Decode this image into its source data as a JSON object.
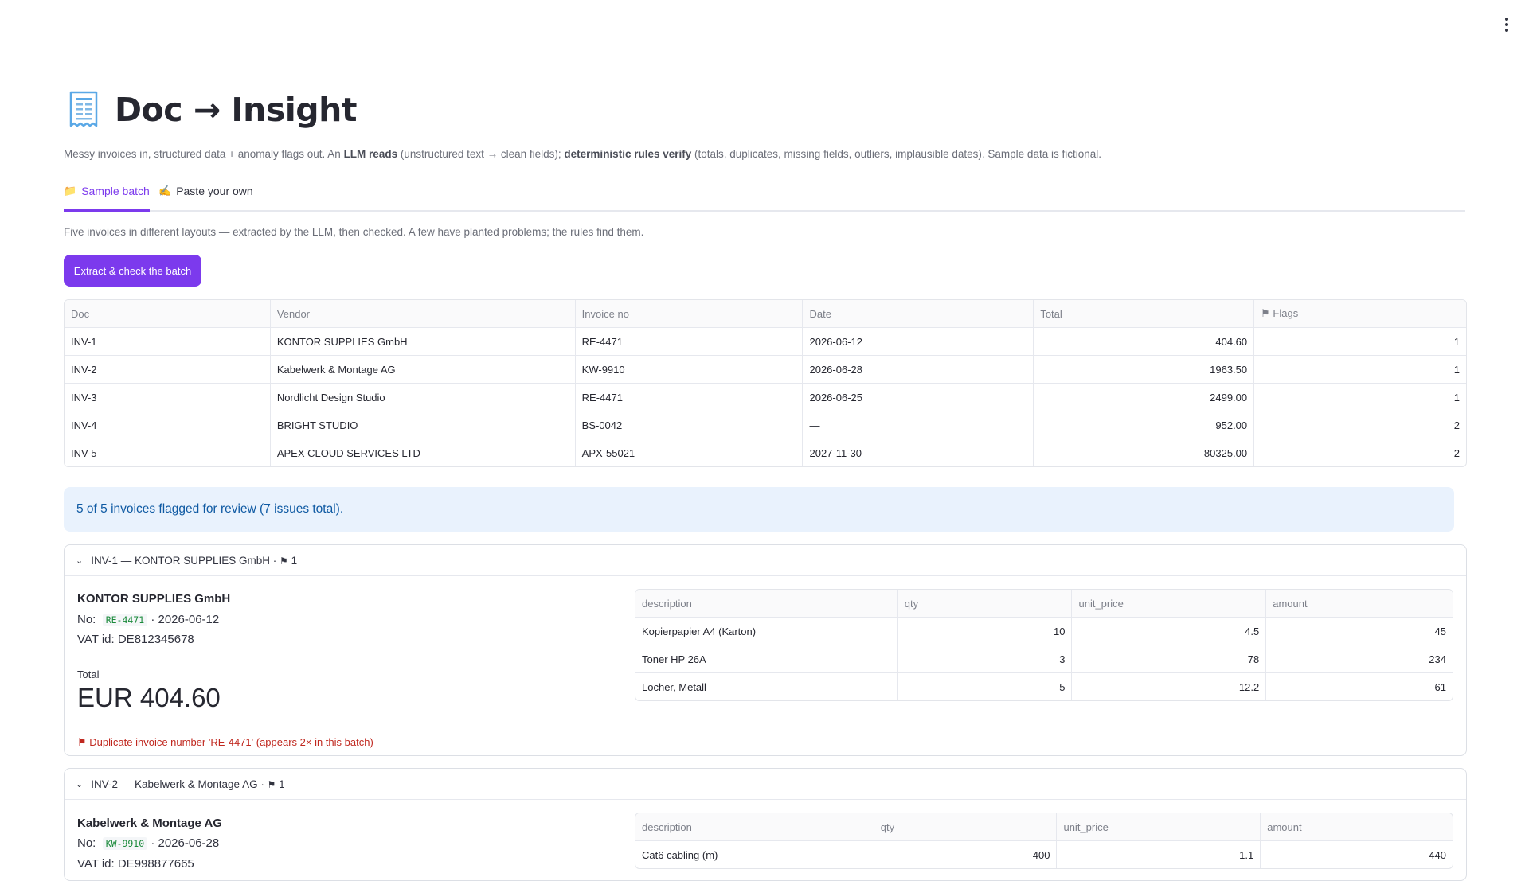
{
  "app": {
    "title": "Doc → Insight",
    "subtitle_parts": [
      "Messy invoices in, structured data + anomaly flags out. An ",
      "LLM reads",
      " (unstructured text → clean fields); ",
      "deterministic rules verify",
      " (totals, duplicates, missing fields, outliers, implausible dates). Sample data is fictional."
    ]
  },
  "tabs": [
    {
      "icon": "📁",
      "label": "Sample batch",
      "active": true
    },
    {
      "icon": "✍️",
      "label": "Paste your own",
      "active": false
    }
  ],
  "sample": {
    "description": "Five invoices in different layouts — extracted by the LLM, then checked. A few have planted problems; the rules find them.",
    "button_label": "Extract & check the batch"
  },
  "results_table": {
    "headers": [
      "Doc",
      "Vendor",
      "Invoice no",
      "Date",
      "Total",
      "Flags"
    ],
    "rows": [
      [
        "INV-1",
        "KONTOR SUPPLIES GmbH",
        "RE-4471",
        "2026-06-12",
        "404.60",
        "1"
      ],
      [
        "INV-2",
        "Kabelwerk & Montage AG",
        "KW-9910",
        "2026-06-28",
        "1963.50",
        "1"
      ],
      [
        "INV-3",
        "Nordlicht Design Studio",
        "RE-4471",
        "2026-06-25",
        "2499.00",
        "1"
      ],
      [
        "INV-4",
        "BRIGHT STUDIO",
        "BS-0042",
        "—",
        "952.00",
        "2"
      ],
      [
        "INV-5",
        "APEX CLOUD SERVICES LTD",
        "APX-55021",
        "2027-11-30",
        "80325.00",
        "2"
      ]
    ]
  },
  "summary": "5 of 5 invoices flagged for review (7 issues total).",
  "expanders": [
    {
      "header": "INV-1 — KONTOR SUPPLIES GmbH ·",
      "flag_count": "1",
      "vendor": "KONTOR SUPPLIES GmbH",
      "no_label": "No:",
      "invoice_no": "RE-4471",
      "date_text": "· 2026-06-12",
      "vat": "VAT id: DE812345678",
      "total_label": "Total",
      "total_value": "EUR 404.60",
      "alert": "Duplicate invoice number 'RE-4471' (appears 2× in this batch)",
      "item_headers": [
        "description",
        "qty",
        "unit_price",
        "amount"
      ],
      "items": [
        [
          "Kopierpapier A4 (Karton)",
          "10",
          "4.5",
          "45"
        ],
        [
          "Toner HP 26A",
          "3",
          "78",
          "234"
        ],
        [
          "Locher, Metall",
          "5",
          "12.2",
          "61"
        ]
      ]
    },
    {
      "header": "INV-2 — Kabelwerk & Montage AG ·",
      "flag_count": "1",
      "vendor": "Kabelwerk & Montage AG",
      "no_label": "No:",
      "invoice_no": "KW-9910",
      "date_text": "· 2026-06-28",
      "vat": "VAT id: DE998877665",
      "item_headers": [
        "description",
        "qty",
        "unit_price",
        "amount"
      ],
      "items": [
        [
          "Cat6 cabling (m)",
          "400",
          "1.1",
          "440"
        ]
      ]
    }
  ]
}
